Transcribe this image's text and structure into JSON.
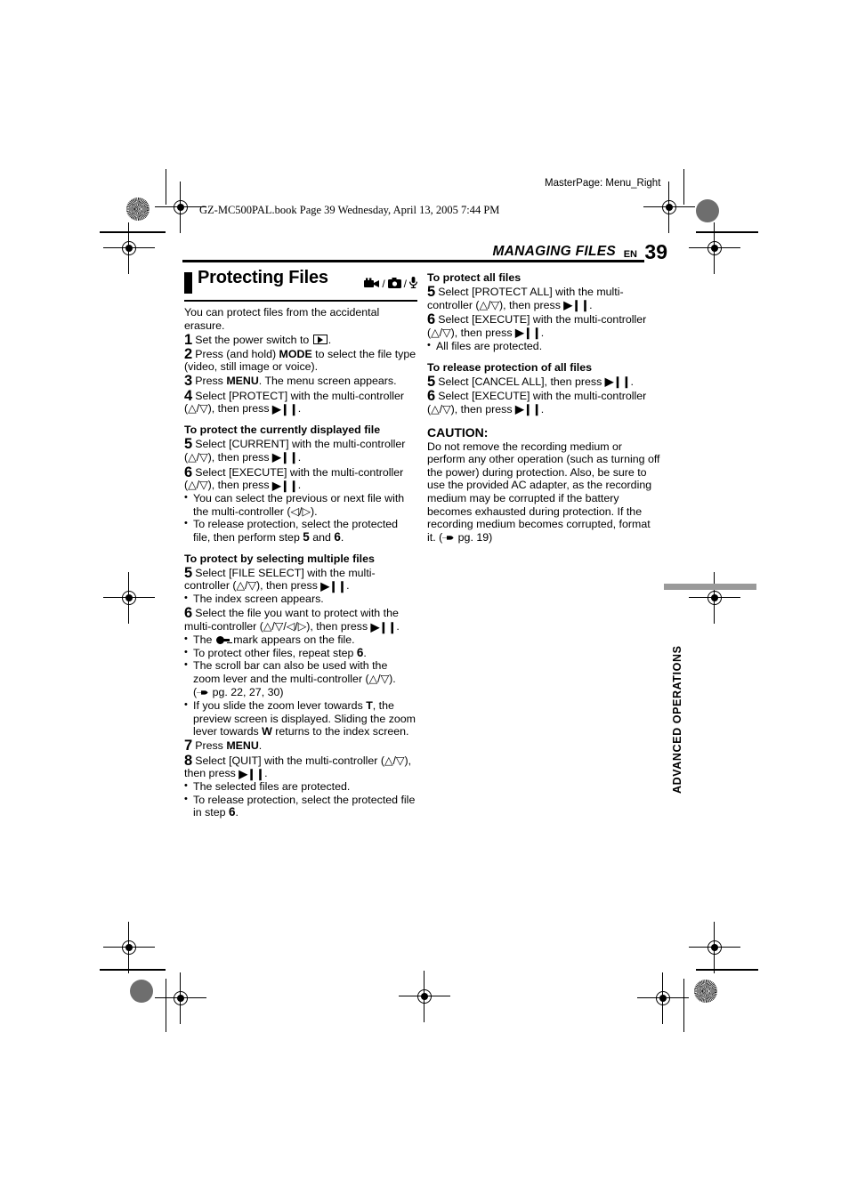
{
  "header": {
    "masterpage": "MasterPage: Menu_Right",
    "bookline": "GZ-MC500PAL.book  Page 39  Wednesday, April 13, 2005  7:44 PM",
    "chapter": "MANAGING FILES",
    "lang": "EN",
    "page_number": "39"
  },
  "section": {
    "title": "Protecting Files",
    "icons": [
      "video-camera-icon",
      "still-camera-icon",
      "microphone-icon"
    ],
    "icon_separator": "/",
    "intro": "You can protect files from the accidental erasure."
  },
  "left_column": {
    "steps": [
      {
        "num": "1",
        "text_a": "Set the power switch to ",
        "icon": "play-mode-icon",
        "text_b": "."
      },
      {
        "num": "2",
        "text_a": "Press (and hold) ",
        "bold": "MODE",
        "text_b": " to select the file type (video, still image or voice)."
      },
      {
        "num": "3",
        "text_a": "Press ",
        "bold": "MENU",
        "text_b": ". The menu screen appears."
      },
      {
        "num": "4",
        "text_a": "Select [PROTECT] with the multi-controller (",
        "nav": "up-down",
        "text_b": "), then press ",
        "btn": "play-pause-icon",
        "text_c": "."
      }
    ],
    "sub_current": {
      "heading": "To protect the currently displayed file",
      "steps": [
        {
          "num": "5",
          "text_a": "Select [CURRENT] with the multi-controller (",
          "nav": "up-down",
          "text_b": "), then press ",
          "btn": "play-pause-icon",
          "text_c": "."
        },
        {
          "num": "6",
          "text_a": "Select [EXECUTE] with the multi-controller (",
          "nav": "up-down",
          "text_b": "), then press ",
          "btn": "play-pause-icon",
          "text_c": "."
        }
      ],
      "bullets": [
        {
          "text_a": "You can select the previous or next file with the multi-controller (",
          "nav": "left-right",
          "text_b": ")."
        },
        {
          "text_a": "To release protection, select the protected file, then perform step ",
          "ref1": "5",
          "text_b": " and ",
          "ref2": "6",
          "text_c": "."
        }
      ]
    },
    "sub_multiple": {
      "heading": "To protect by selecting multiple files",
      "step5": {
        "num": "5",
        "text_a": "Select [FILE SELECT] with the multi-controller (",
        "nav": "up-down",
        "text_b": "), then press ",
        "btn": "play-pause-icon",
        "text_c": "."
      },
      "step5_bullets": [
        {
          "text_a": "The index screen appears."
        }
      ],
      "step6": {
        "num": "6",
        "text_a": "Select the file you want to protect with the multi-controller (",
        "nav": "up-down-left-right",
        "text_b": "), then press ",
        "btn": "play-pause-icon",
        "text_c": "."
      },
      "step6_bullets": [
        {
          "text_a": "The ",
          "icon": "key-lock-icon",
          "text_b": " mark appears on the file."
        },
        {
          "text_a": "To protect other files, repeat step ",
          "ref1": "6",
          "text_b": "."
        },
        {
          "text_a": "The scroll bar can also be used with the zoom lever and the multi-controller (",
          "nav": "up-down",
          "text_b": ").",
          "ref_line_icon": "pointing-hand-icon",
          "ref_line": " pg. 22, 27, 30)",
          "ref_open": "("
        },
        {
          "text_a": "If you slide the zoom lever towards ",
          "bold1": "T",
          "text_b": ", the preview screen is displayed. Sliding the zoom lever towards ",
          "bold2": "W",
          "text_c": " returns to the index screen."
        }
      ],
      "step7": {
        "num": "7",
        "text_a": "Press ",
        "bold": "MENU",
        "text_b": "."
      },
      "step8": {
        "num": "8",
        "text_a": "Select [QUIT] with the multi-controller (",
        "nav": "up-down",
        "text_b": "), then press ",
        "btn": "play-pause-icon",
        "text_c": "."
      },
      "step8_bullets": [
        {
          "text_a": "The selected files are protected."
        },
        {
          "text_a": "To release protection, select the protected file in step ",
          "ref1": "6",
          "text_b": "."
        }
      ]
    }
  },
  "right_column": {
    "sub_all": {
      "heading": "To protect all files",
      "steps": [
        {
          "num": "5",
          "text_a": "Select [PROTECT ALL] with the multi-controller (",
          "nav": "up-down",
          "text_b": "), then press ",
          "btn": "play-pause-icon",
          "text_c": "."
        },
        {
          "num": "6",
          "text_a": "Select [EXECUTE] with the multi-controller (",
          "nav": "up-down",
          "text_b": "), then press ",
          "btn": "play-pause-icon",
          "text_c": "."
        }
      ],
      "bullets": [
        {
          "text_a": "All files are protected."
        }
      ]
    },
    "sub_release_all": {
      "heading": "To release protection of all files",
      "steps": [
        {
          "num": "5",
          "text_a": "Select [CANCEL ALL], then press ",
          "btn": "play-pause-icon",
          "text_c": "."
        },
        {
          "num": "6",
          "text_a": "Select [EXECUTE] with the multi-controller (",
          "nav": "up-down",
          "text_b": "), then press ",
          "btn": "play-pause-icon",
          "text_c": "."
        }
      ]
    },
    "caution": {
      "heading": "CAUTION:",
      "body_a": "Do not remove the recording medium or perform any other operation (such as turning off the power) during protection. Also, be sure to use the provided AC adapter, as the recording medium may be corrupted if the battery becomes exhausted during protection. If the recording medium becomes corrupted, format it. (",
      "ref_icon": "pointing-hand-icon",
      "body_b": " pg. 19)"
    }
  },
  "thumb_tab": {
    "label": "ADVANCED OPERATIONS",
    "bar_color": "#9a9a9a"
  }
}
